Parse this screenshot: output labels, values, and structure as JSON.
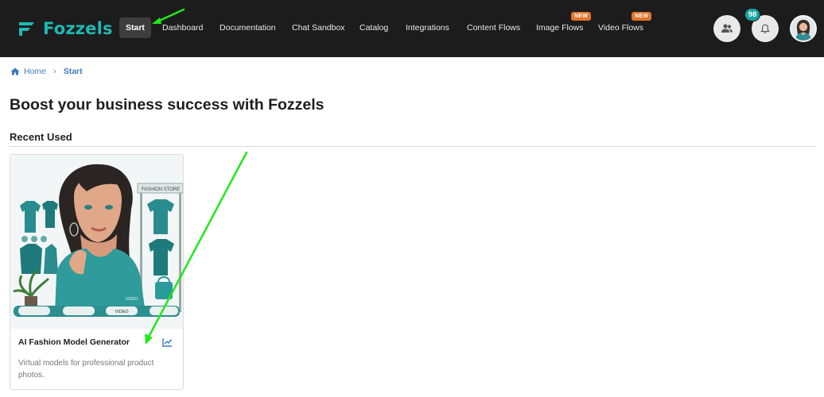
{
  "app": {
    "name": "Fozzels"
  },
  "nav": {
    "items": [
      {
        "label": "Start",
        "active": true
      },
      {
        "label": "Dashboard"
      },
      {
        "label": "Documentation"
      },
      {
        "label": "Chat Sandbox"
      },
      {
        "label": "Catalog"
      },
      {
        "label": "Integrations"
      },
      {
        "label": "Content Flows"
      },
      {
        "label": "Image Flows",
        "badge": "NEW"
      },
      {
        "label": "Video Flows",
        "badge": "NEW"
      }
    ]
  },
  "header": {
    "notification_count": "98",
    "icons": [
      "users-icon",
      "bell-icon",
      "avatar"
    ]
  },
  "breadcrumb": {
    "home": "Home",
    "current": "Start"
  },
  "page": {
    "title": "Boost your business success with Fozzels",
    "section_title": "Recent Used"
  },
  "cards": [
    {
      "title": "AI Fashion Model Generator",
      "description": "Virtual models for professional product photos.",
      "image_labels": {
        "store_sign": "FASHION STORE",
        "video": "VIDEO"
      }
    }
  ],
  "colors": {
    "topbar": "#1c1c1c",
    "brand": "#1fb8b4",
    "accent_link": "#3c7bbf",
    "new_badge": "#e3762b",
    "annotation_arrow": "#22e81a"
  }
}
